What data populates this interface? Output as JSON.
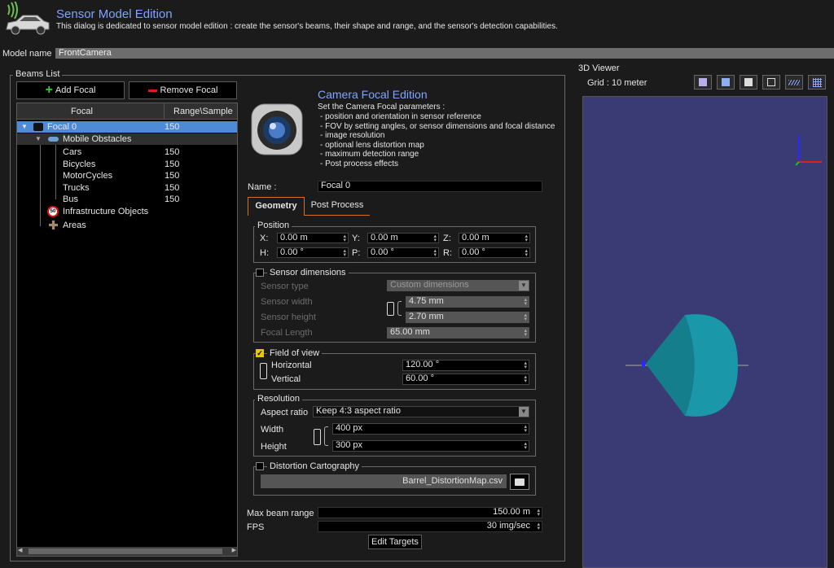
{
  "header": {
    "title": "Sensor Model Edition",
    "description": "This dialog is dedicated to sensor model edition : create the sensor's beams, their shape and range, and the sensor's detection capabilities."
  },
  "model": {
    "label": "Model name",
    "value": "FrontCamera"
  },
  "beams": {
    "title": "Beams List",
    "add_label": "Add Focal",
    "remove_label": "Remove Focal",
    "col_focal": "Focal",
    "col_range": "Range\\Sample",
    "items": {
      "focal0": {
        "label": "Focal 0",
        "value": "150"
      },
      "mobile": {
        "label": "Mobile Obstacles"
      },
      "cars": {
        "label": "Cars",
        "value": "150"
      },
      "bicycles": {
        "label": "Bicycles",
        "value": "150"
      },
      "motorcycles": {
        "label": "MotorCycles",
        "value": "150"
      },
      "trucks": {
        "label": "Trucks",
        "value": "150"
      },
      "bus": {
        "label": "Bus",
        "value": "150"
      },
      "infra": {
        "label": "Infrastructure Objects"
      },
      "areas": {
        "label": "Areas"
      }
    }
  },
  "focal": {
    "title": "Camera Focal Edition",
    "intro": "Set the Camera Focal parameters :",
    "bullets": [
      "- position and orientation in sensor reference",
      "- FOV by setting angles, or sensor dimensions and focal distance",
      "- image resolution",
      "- optional lens distortion map",
      "- maximum detection range",
      "- Post process effects"
    ],
    "name_label": "Name :",
    "name_value": "Focal 0",
    "tabs": [
      "Geometry",
      "Post Process"
    ],
    "position": {
      "title": "Position",
      "x_label": "X:",
      "x": "0.00 m",
      "y_label": "Y:",
      "y": "0.00 m",
      "z_label": "Z:",
      "z": "0.00 m",
      "h_label": "H:",
      "h": "0.00 °",
      "p_label": "P:",
      "p": "0.00 °",
      "r_label": "R:",
      "r": "0.00 °"
    },
    "sensor": {
      "title": "Sensor dimensions",
      "type_label": "Sensor type",
      "type_value": "Custom dimensions",
      "width_label": "Sensor width",
      "width_value": "4.75 mm",
      "height_label": "Sensor height",
      "height_value": "2.70 mm",
      "focal_label": "Focal Length",
      "focal_value": "65.00 mm"
    },
    "fov": {
      "title": "Field of view",
      "h_label": "Horizontal",
      "h_value": "120.00 °",
      "v_label": "Vertical",
      "v_value": "60.00 °"
    },
    "resolution": {
      "title": "Resolution",
      "aspect_label": "Aspect ratio",
      "aspect_value": "Keep 4:3 aspect ratio",
      "width_label": "Width",
      "width_value": "400 px",
      "height_label": "Height",
      "height_value": "300 px"
    },
    "distortion": {
      "title": "Distortion Cartography",
      "file": "Barrel_DistortionMap.csv"
    },
    "max_range_label": "Max beam range",
    "max_range_value": "150.00 m",
    "fps_label": "FPS",
    "fps_value": "30 img/sec",
    "edit_targets": "Edit Targets"
  },
  "viewer": {
    "title": "3D Viewer",
    "grid": "Grid : 10 meter"
  },
  "colors": {
    "accent": "#7fa4ff",
    "selection": "#4d8bd6",
    "viewer_bg": "#3a3a74",
    "frustum": "#1a8a9a",
    "checkbox_on": "#e8c800"
  }
}
